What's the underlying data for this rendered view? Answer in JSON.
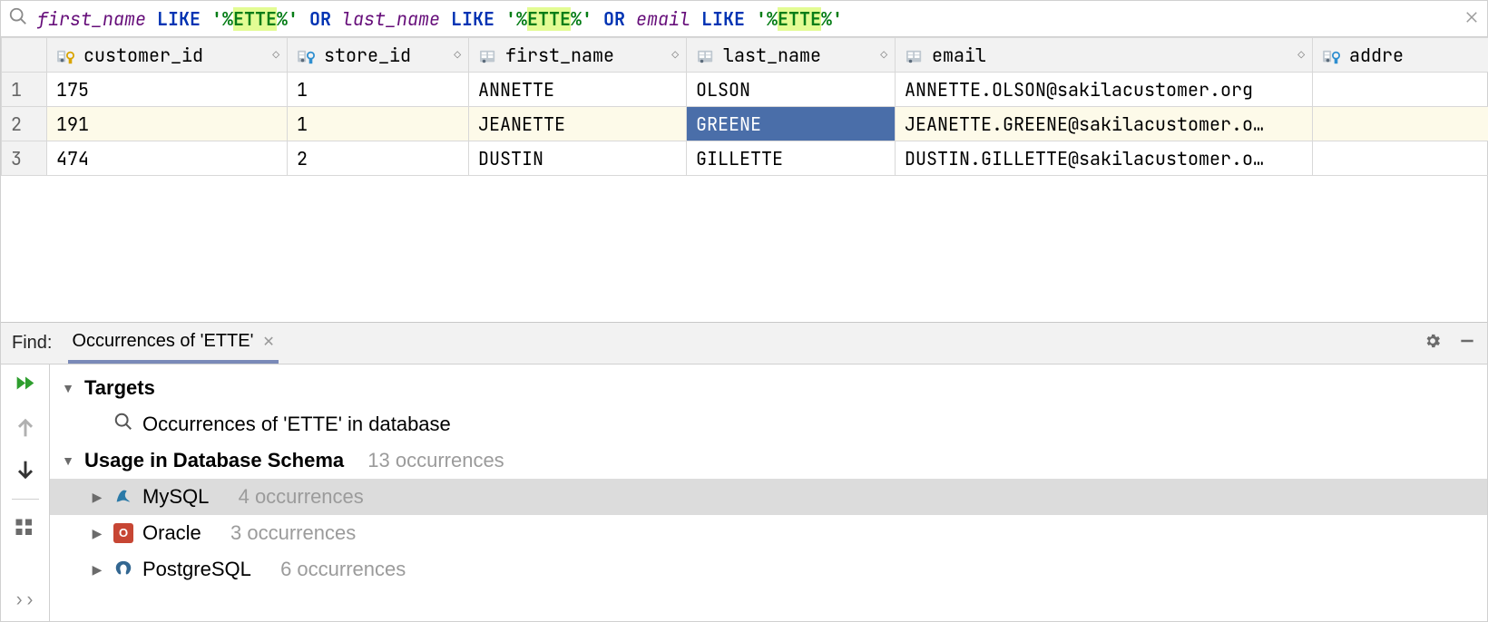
{
  "filter": {
    "tokens": [
      {
        "t": "col",
        "v": "first_name"
      },
      {
        "t": "sp",
        "v": " "
      },
      {
        "t": "kw",
        "v": "LIKE"
      },
      {
        "t": "sp",
        "v": " "
      },
      {
        "t": "str",
        "v": "'%"
      },
      {
        "t": "str-hl",
        "v": "ETTE"
      },
      {
        "t": "str",
        "v": "%'"
      },
      {
        "t": "sp",
        "v": " "
      },
      {
        "t": "kw",
        "v": "OR"
      },
      {
        "t": "sp",
        "v": " "
      },
      {
        "t": "col",
        "v": "last_name"
      },
      {
        "t": "sp",
        "v": " "
      },
      {
        "t": "kw",
        "v": "LIKE"
      },
      {
        "t": "sp",
        "v": " "
      },
      {
        "t": "str",
        "v": "'%"
      },
      {
        "t": "str-hl",
        "v": "ETTE"
      },
      {
        "t": "str",
        "v": "%'"
      },
      {
        "t": "sp",
        "v": " "
      },
      {
        "t": "kw",
        "v": "OR"
      },
      {
        "t": "sp",
        "v": " "
      },
      {
        "t": "col",
        "v": "email"
      },
      {
        "t": "sp",
        "v": " "
      },
      {
        "t": "kw",
        "v": "LIKE"
      },
      {
        "t": "sp",
        "v": " "
      },
      {
        "t": "str",
        "v": "'%"
      },
      {
        "t": "str-hl",
        "v": "ETTE"
      },
      {
        "t": "str",
        "v": "%'"
      }
    ]
  },
  "columns": [
    {
      "name": "customer_id",
      "icon": "pk"
    },
    {
      "name": "store_id",
      "icon": "fk"
    },
    {
      "name": "first_name",
      "icon": "col"
    },
    {
      "name": "last_name",
      "icon": "col",
      "highlight": true
    },
    {
      "name": "email",
      "icon": "col"
    },
    {
      "name": "addre",
      "icon": "fk",
      "truncated": true
    }
  ],
  "rows": [
    {
      "num": "1",
      "cells": [
        "175",
        "1",
        "ANNETTE",
        "OLSON",
        "ANNETTE.OLSON@sakilacustomer.org",
        ""
      ],
      "hl": false
    },
    {
      "num": "2",
      "cells": [
        "191",
        "1",
        "JEANETTE",
        "GREENE",
        "JEANETTE.GREENE@sakilacustomer.o…",
        ""
      ],
      "hl": true,
      "selCol": 3
    },
    {
      "num": "3",
      "cells": [
        "474",
        "2",
        "DUSTIN",
        "GILLETTE",
        "DUSTIN.GILLETTE@sakilacustomer.o…",
        ""
      ],
      "hl": false
    }
  ],
  "findPanel": {
    "label": "Find:",
    "tabTitle": "Occurrences of 'ETTE'",
    "tree": {
      "targetsLabel": "Targets",
      "targetLine": "Occurrences of 'ETTE' in database",
      "usageLabel": "Usage in Database Schema",
      "usageCount": "13 occurrences",
      "items": [
        {
          "db": "MySQL",
          "count": "4 occurrences",
          "icon": "mysql",
          "selected": true
        },
        {
          "db": "Oracle",
          "count": "3 occurrences",
          "icon": "oracle"
        },
        {
          "db": "PostgreSQL",
          "count": "6 occurrences",
          "icon": "pg"
        }
      ]
    }
  }
}
